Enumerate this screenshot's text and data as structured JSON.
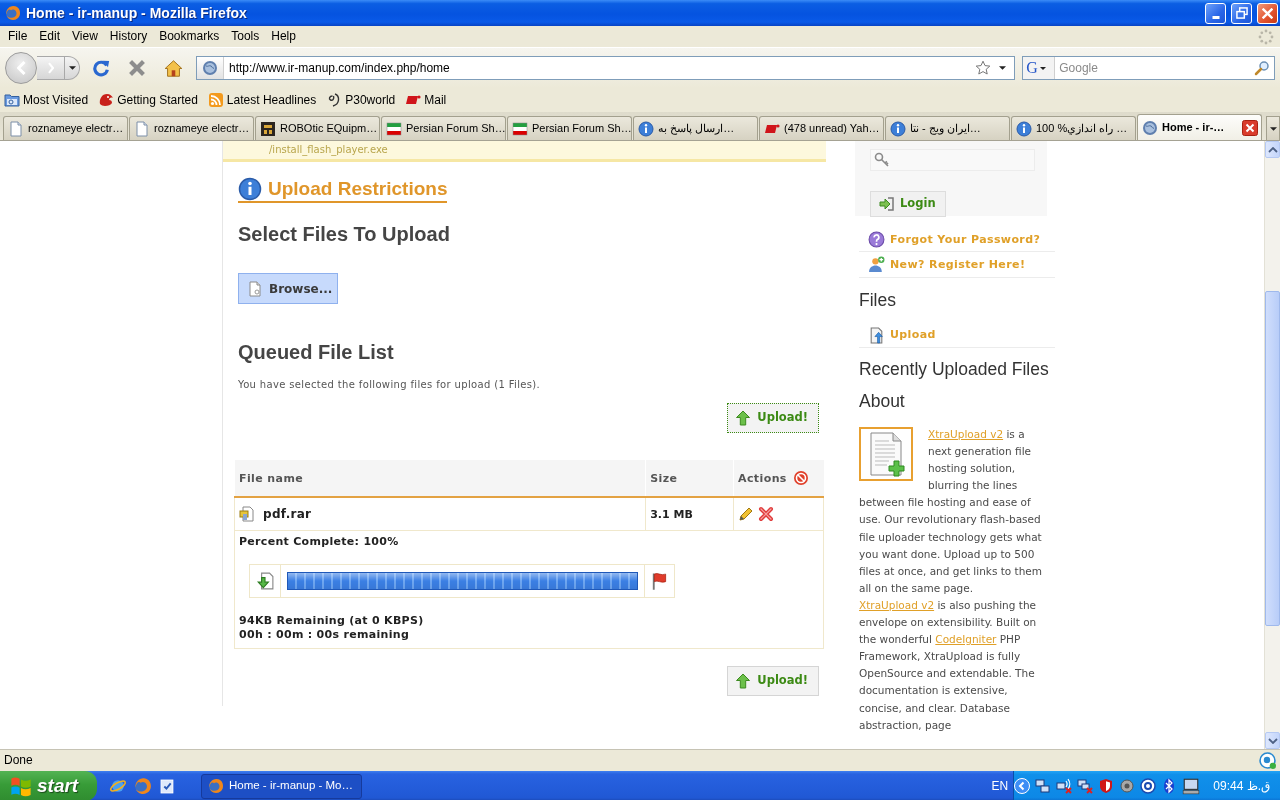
{
  "window": {
    "title": "Home - ir-manup - Mozilla Firefox"
  },
  "menu": [
    "File",
    "Edit",
    "View",
    "History",
    "Bookmarks",
    "Tools",
    "Help"
  ],
  "navigation": {
    "address": "http://www.ir-manup.com/index.php/home",
    "search_engine": "G",
    "search_placeholder": "Google"
  },
  "bookmarks": [
    {
      "label": "Most Visited",
      "kind": "folder"
    },
    {
      "label": "Getting Started",
      "kind": "logo"
    },
    {
      "label": "Latest Headlines",
      "kind": "feed"
    },
    {
      "label": "P30world",
      "kind": "swirl"
    },
    {
      "label": "Mail",
      "kind": "mail"
    }
  ],
  "tabs": [
    {
      "label": "roznameye electr…",
      "kind": "page",
      "selected": false
    },
    {
      "label": "roznameye electr…",
      "kind": "page",
      "selected": false
    },
    {
      "label": "ROBOtic EQuipm…",
      "kind": "logo",
      "selected": false
    },
    {
      "label": "Persian Forum Sh…",
      "kind": "flag",
      "selected": false
    },
    {
      "label": "Persian Forum Sh…",
      "kind": "flag",
      "selected": false
    },
    {
      "label": "ارسال پاسخ به…",
      "kind": "info",
      "selected": false
    },
    {
      "label": "(478 unread) Yah…",
      "kind": "mail",
      "selected": false
    },
    {
      "label": "ایران ویج - نتا…",
      "kind": "info",
      "selected": false
    },
    {
      "label": "100 %راه اندازي …",
      "kind": "info",
      "selected": false
    },
    {
      "label": "Home - ir-…",
      "kind": "globe",
      "selected": true
    }
  ],
  "page": {
    "notice": "/install_flash_player.exe",
    "restrictions_link": "Upload Restrictions",
    "select_heading": "Select Files To Upload",
    "browse_button": "Browse...",
    "queue_heading": "Queued File List",
    "queue_summary": "You have selected the following files for upload (1 Files).",
    "upload_buttons": [
      {
        "label": "Upload!",
        "focused": true
      },
      {
        "label": "Upload!",
        "focused": false
      }
    ],
    "table": {
      "columns": [
        "File name",
        "Size",
        "Actions"
      ],
      "rows": [
        {
          "name": "pdf.rar",
          "size": "3.1 MB",
          "progress": {
            "label": "Percent Complete: 100%",
            "level": 1,
            "remaining": "94KB Remaining (at 0 KBPS)",
            "time_left": "00h : 00m : 00s remaining"
          }
        }
      ]
    }
  },
  "sidebar": {
    "login_button": "Login",
    "links": [
      {
        "label": "Forgot Your Password?",
        "kind": "help"
      },
      {
        "label": "New? Register Here!",
        "kind": "register"
      }
    ],
    "files_heading": "Files",
    "file_links": [
      "Upload"
    ],
    "recent_heading": "Recently Uploaded Files",
    "about_heading": "About",
    "about_text_beside_image": [
      {
        "kind": "link",
        "text": "XtraUpload v2"
      },
      {
        "kind": "text",
        "text": " is a next generation file hosting solution, blurring the lines"
      }
    ],
    "about_text_below_image": [
      {
        "kind": "text",
        "text": "between file hosting and ease of use. Our revolutionary flash-based file uploader technology gets what you want done. Upload up to 500 files at once, and get links to them all on the same page. "
      },
      {
        "kind": "link",
        "text": "XtraUpload v2"
      },
      {
        "kind": "text",
        "text": " is also pushing the envelope on extensibility. Built on the wonderful "
      },
      {
        "kind": "link",
        "text": "CodeIgniter"
      },
      {
        "kind": "text",
        "text": " PHP Framework, XtraUpload is fully OpenSource and extendable. The documentation is extensive, concise, and clear. Database abstraction, page"
      }
    ]
  },
  "status_bar": {
    "text": "Done"
  },
  "taskbar": {
    "start": "start",
    "task": "Home - ir-manup - Mo…",
    "language": "EN",
    "clock": "09:44 ق.ظ"
  }
}
